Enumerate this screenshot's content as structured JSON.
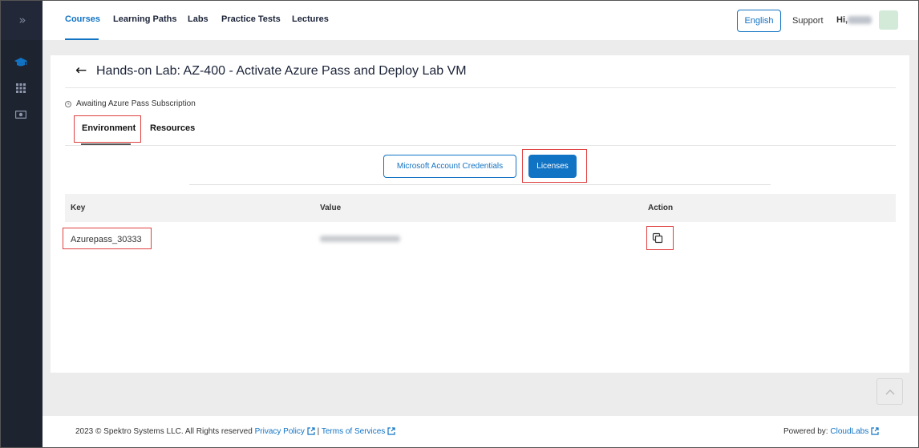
{
  "sidebar": {
    "toggle_glyph": "»",
    "icons": [
      "graduation-cap-icon",
      "grid-icon",
      "money-icon"
    ],
    "accent": "#1173c4"
  },
  "topnav": {
    "items": [
      "Courses",
      "Learning Paths",
      "Labs",
      "Practice Tests",
      "Lectures"
    ],
    "active": "Courses",
    "language_button": "English",
    "support": "Support",
    "greeting": "Hi,"
  },
  "lab": {
    "title": "Hands-on Lab: AZ-400 - Activate Azure Pass and Deploy Lab VM",
    "status": "Awaiting Azure Pass Subscription",
    "tabs": [
      "Environment",
      "Resources"
    ],
    "active_tab": "Environment",
    "subtabs": [
      "Microsoft Account Credentials",
      "Licenses"
    ],
    "active_subtab": "Licenses",
    "table": {
      "columns": [
        "Key",
        "Value",
        "Action"
      ],
      "rows": [
        {
          "key": "Azurepass_30333",
          "value_redacted": true
        }
      ]
    }
  },
  "footer": {
    "copyright": "2023 © Spektro Systems LLC. All Rights reserved",
    "privacy": "Privacy Policy",
    "separator": "|",
    "terms": "Terms of Services",
    "powered_by": "Powered by:",
    "brand": "CloudLabs"
  },
  "colors": {
    "primary": "#1173c4",
    "highlight": "#e04141",
    "sidebar_bg": "#1e2330",
    "page_bg": "#ececec"
  }
}
